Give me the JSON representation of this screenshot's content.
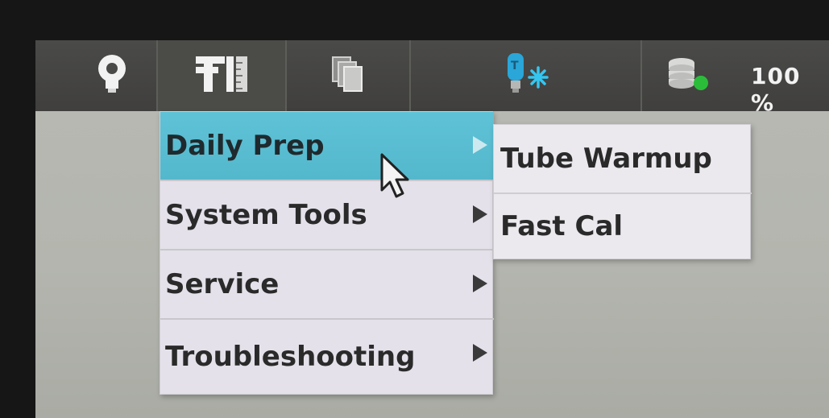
{
  "toolbar": {
    "zoom_text": "100 %",
    "buttons": [
      {
        "icon": "lightbulb-icon"
      },
      {
        "icon": "tools-ruler-icon"
      },
      {
        "icon": "cards-stack-icon"
      },
      {
        "icon": "tube-star-icon"
      },
      {
        "icon": "database-status-icon"
      }
    ],
    "status_color": "#2bbd3a"
  },
  "menu": {
    "items": [
      {
        "label": "Daily Prep",
        "highlighted": true
      },
      {
        "label": "System Tools"
      },
      {
        "label": "Service"
      },
      {
        "label": "Troubleshooting"
      }
    ]
  },
  "submenu": {
    "items": [
      {
        "label": "Tube Warmup"
      },
      {
        "label": "Fast Cal"
      }
    ]
  },
  "colors": {
    "highlight": "#5fc2d6",
    "menu_bg": "#e4e1ea",
    "toolbar_bg": "#444442"
  }
}
